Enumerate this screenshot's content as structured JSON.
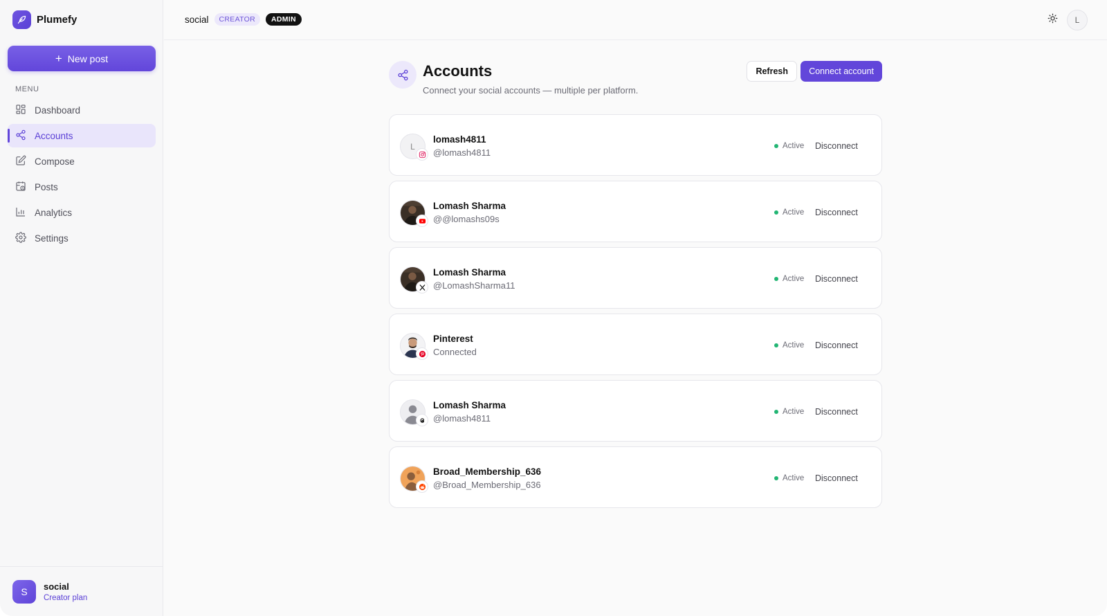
{
  "app": {
    "name": "Plumefy"
  },
  "sidebar": {
    "new_post_label": "New post",
    "menu_heading": "MENU",
    "items": [
      {
        "label": "Dashboard",
        "icon": "dashboard-icon",
        "active": false
      },
      {
        "label": "Accounts",
        "icon": "share-icon",
        "active": true
      },
      {
        "label": "Compose",
        "icon": "compose-icon",
        "active": false
      },
      {
        "label": "Posts",
        "icon": "calendar-clock-icon",
        "active": false
      },
      {
        "label": "Analytics",
        "icon": "bar-chart-icon",
        "active": false
      },
      {
        "label": "Settings",
        "icon": "gear-icon",
        "active": false
      }
    ],
    "footer": {
      "avatar_letter": "S",
      "name": "social",
      "plan": "Creator plan"
    }
  },
  "topbar": {
    "workspace": "social",
    "role_badge": "CREATOR",
    "admin_badge": "ADMIN",
    "user_avatar_letter": "L"
  },
  "page": {
    "title": "Accounts",
    "subtitle": "Connect your social accounts — multiple per platform.",
    "refresh_label": "Refresh",
    "connect_label": "Connect account"
  },
  "accounts": [
    {
      "name": "lomash4811",
      "handle": "@lomash4811",
      "platform": "instagram",
      "status": "Active",
      "action": "Disconnect",
      "avatar_letter": "L"
    },
    {
      "name": "Lomash Sharma",
      "handle": "@@lomashs09s",
      "platform": "youtube",
      "status": "Active",
      "action": "Disconnect",
      "avatar_letter": ""
    },
    {
      "name": "Lomash Sharma",
      "handle": "@LomashSharma11",
      "platform": "x",
      "status": "Active",
      "action": "Disconnect",
      "avatar_letter": ""
    },
    {
      "name": "Pinterest",
      "handle": "Connected",
      "platform": "pinterest",
      "status": "Active",
      "action": "Disconnect",
      "avatar_letter": ""
    },
    {
      "name": "Lomash Sharma",
      "handle": "@lomash4811",
      "platform": "threads",
      "status": "Active",
      "action": "Disconnect",
      "avatar_letter": ""
    },
    {
      "name": "Broad_Membership_636",
      "handle": "@Broad_Membership_636",
      "platform": "reddit",
      "status": "Active",
      "action": "Disconnect",
      "avatar_letter": ""
    }
  ],
  "colors": {
    "accent": "#6246da",
    "accent_light": "#ece8fb",
    "status_active": "#22b573"
  }
}
